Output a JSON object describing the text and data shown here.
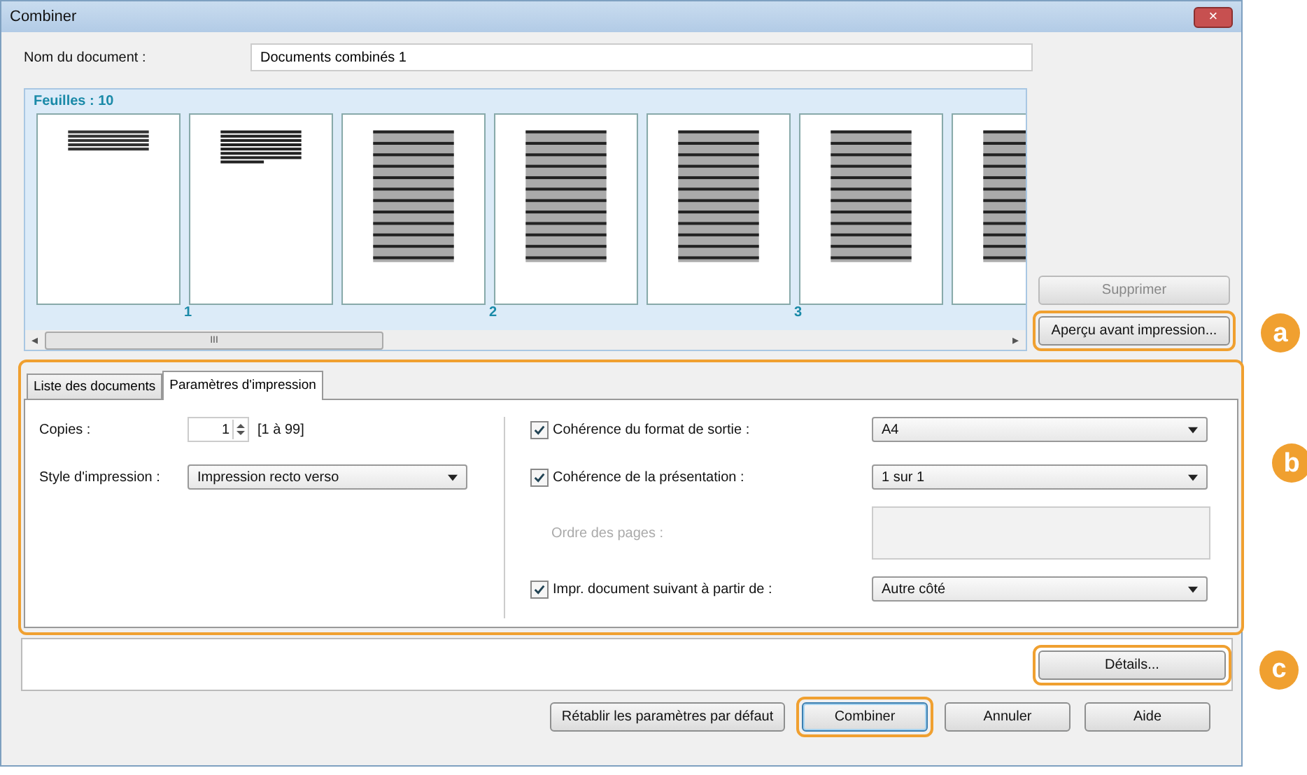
{
  "window": {
    "title": "Combiner",
    "close": "×"
  },
  "document_name": {
    "label": "Nom du document :",
    "value": "Documents combinés 1"
  },
  "sheets": {
    "title": "Feuilles : 10",
    "pages": [
      {
        "kind": "header",
        "number": "1"
      },
      {
        "kind": "list"
      },
      {
        "kind": "table",
        "number": "2"
      },
      {
        "kind": "table"
      },
      {
        "kind": "table",
        "number": "3"
      },
      {
        "kind": "table"
      },
      {
        "kind": "table"
      }
    ],
    "scroll_left": "◂",
    "scroll_right": "▸",
    "scroll_grip": "III"
  },
  "side_buttons": [
    {
      "label": "Supprimer",
      "disabled": true
    },
    {
      "label": "Aperçu avant impression...",
      "disabled": false,
      "callout": "a"
    }
  ],
  "tabs": [
    {
      "label": "Liste des documents",
      "selected": false
    },
    {
      "label": "Paramètres d'impression",
      "selected": true
    }
  ],
  "panel_callout": "b",
  "copies": {
    "label": "Copies :",
    "value": "1",
    "range": "[1 à 99]"
  },
  "print_style": {
    "label": "Style d'impression :",
    "value": "Impression recto verso"
  },
  "options": [
    {
      "label": "Cohérence du format de sortie :",
      "checked": true,
      "disabled": false,
      "value": "A4"
    },
    {
      "label": "Cohérence de la présentation :",
      "checked": true,
      "disabled": false,
      "value": "1 sur 1"
    },
    {
      "label": "Ordre des pages :",
      "disabled": true
    },
    {
      "label": "Impr. document suivant à partir de :",
      "checked": true,
      "disabled": false,
      "value": "Autre côté"
    }
  ],
  "details": {
    "label": "Détails...",
    "callout": "c"
  },
  "footer_buttons": [
    {
      "label": "Rétablir les paramètres par défaut",
      "highlighted": false
    },
    {
      "label": "Combiner",
      "highlighted": true
    },
    {
      "label": "Annuler",
      "highlighted": false
    },
    {
      "label": "Aide",
      "highlighted": false
    }
  ]
}
